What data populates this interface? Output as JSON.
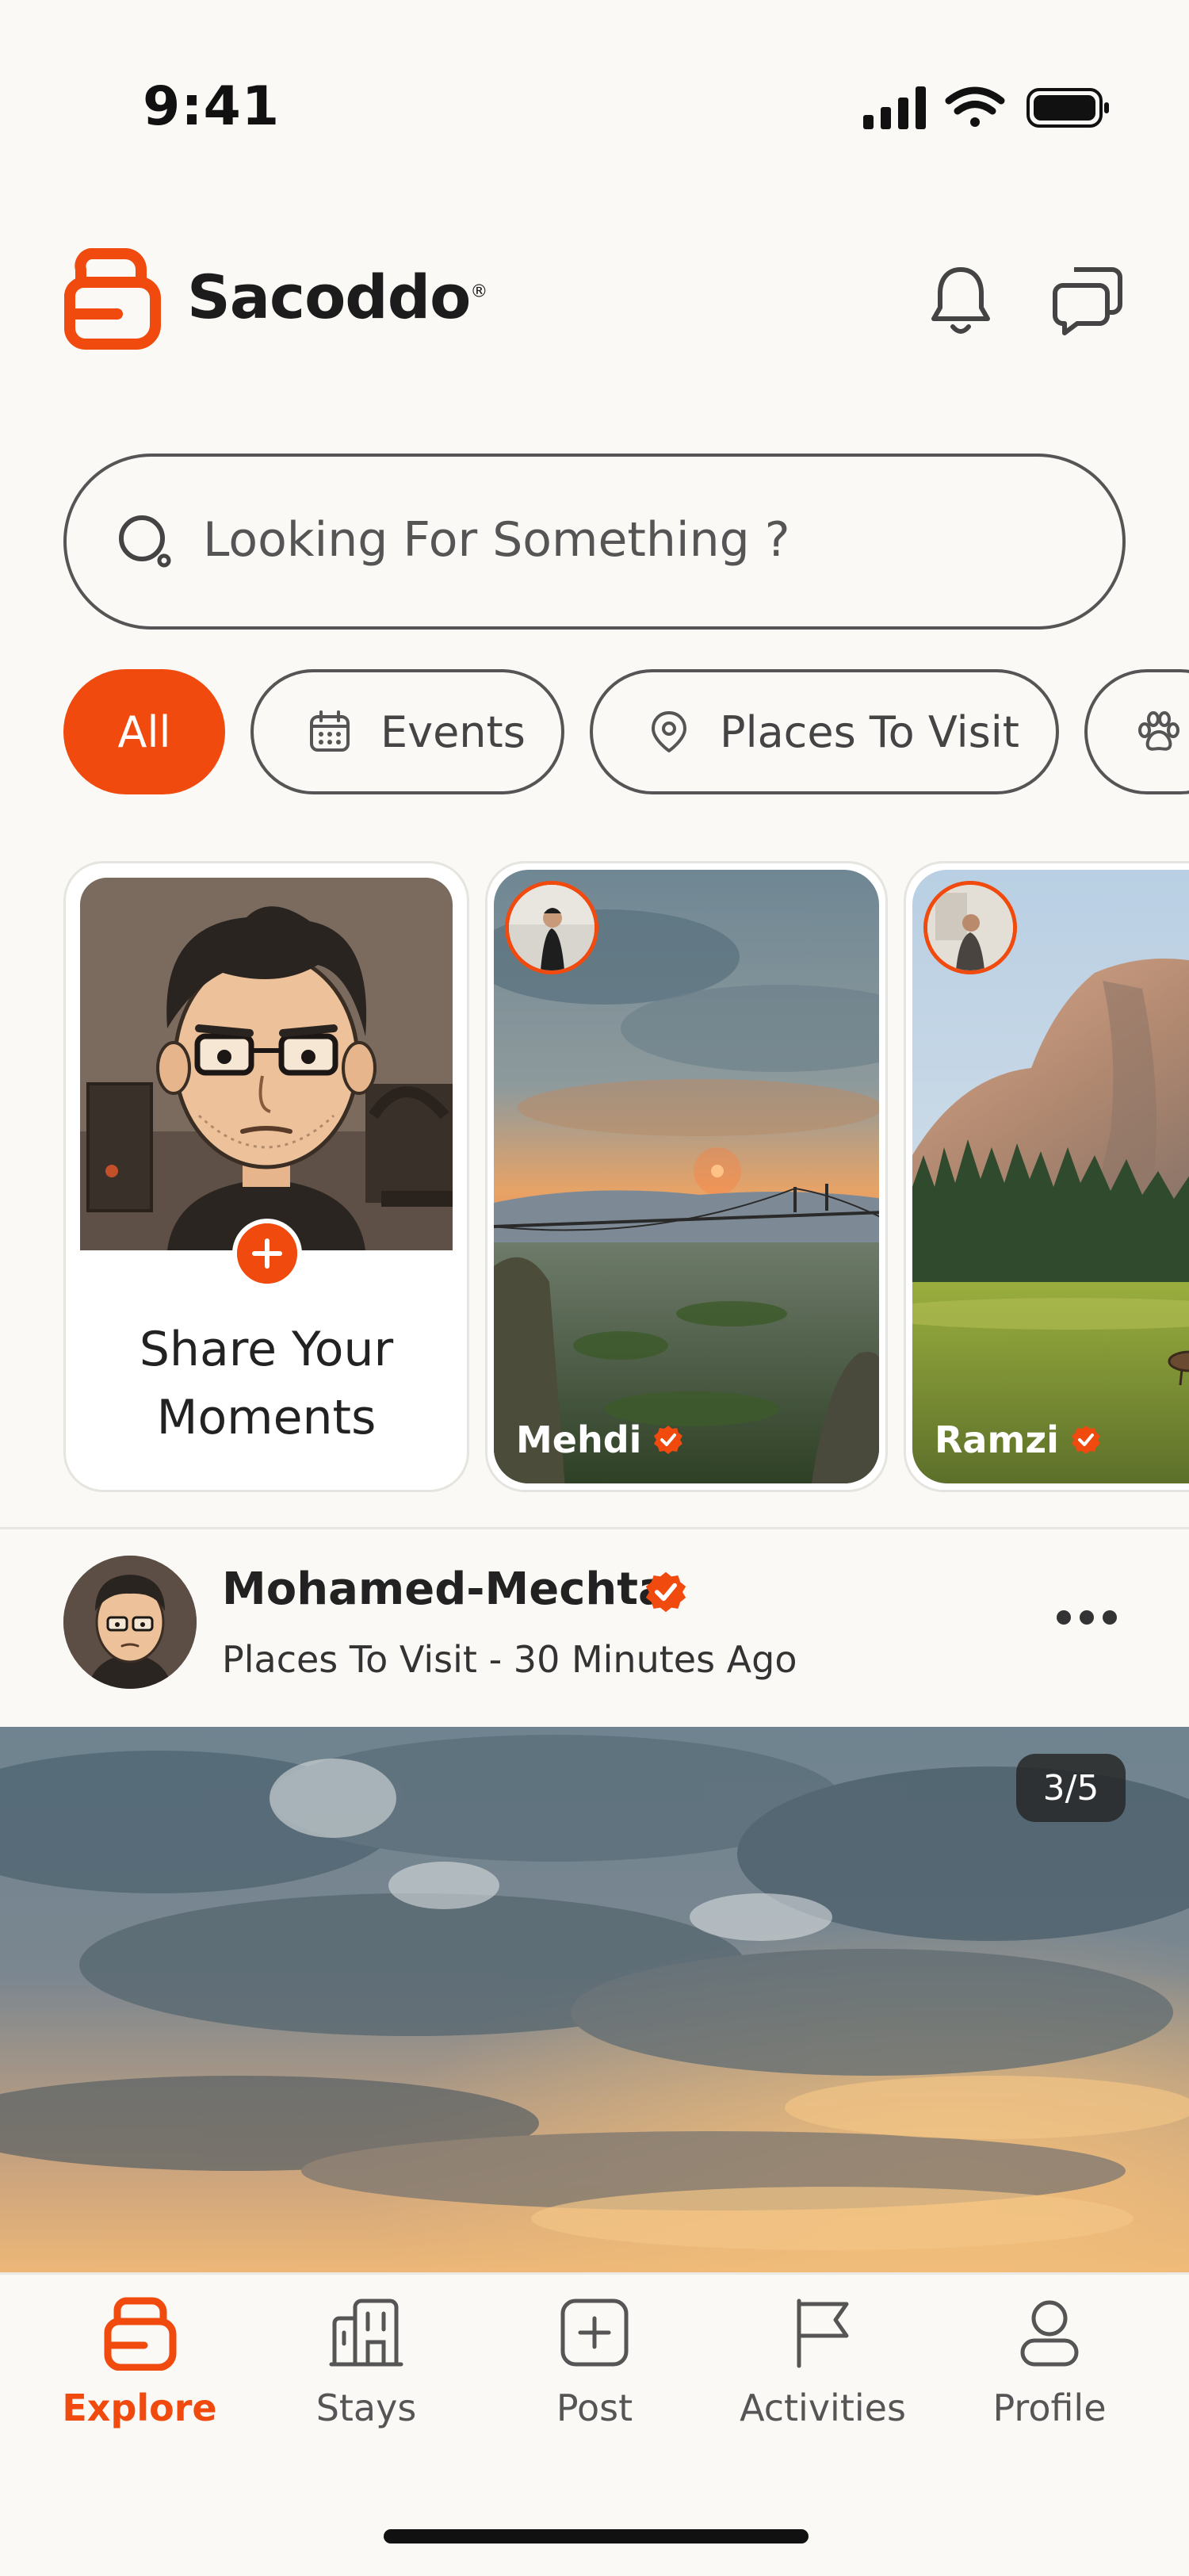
{
  "status_bar": {
    "time": "9:41"
  },
  "header": {
    "brand": "Sacoddo",
    "brand_mark": "®"
  },
  "search": {
    "placeholder": "Looking For Something ?"
  },
  "chips": [
    {
      "label": "All",
      "active": true
    },
    {
      "label": "Events",
      "icon": "calendar-icon"
    },
    {
      "label": "Places To Visit",
      "icon": "location-pin-icon"
    },
    {
      "label": "",
      "icon": "paw-icon"
    }
  ],
  "stories": {
    "share": {
      "label_line1": "Share Your",
      "label_line2": "Moments"
    },
    "items": [
      {
        "name": "Mehdi",
        "verified": true
      },
      {
        "name": "Ramzi",
        "verified": true
      }
    ]
  },
  "post": {
    "author": "Mohamed-Mechta",
    "verified": true,
    "meta": "Places To Visit - 30 Minutes Ago",
    "image_counter": "3/5"
  },
  "tabs": [
    {
      "label": "Explore",
      "icon": "explore-icon",
      "active": true
    },
    {
      "label": "Stays",
      "icon": "building-icon"
    },
    {
      "label": "Post",
      "icon": "add-post-icon"
    },
    {
      "label": "Activities",
      "icon": "flag-icon"
    },
    {
      "label": "Profile",
      "icon": "profile-icon"
    }
  ],
  "colors": {
    "accent": "#F04A0E",
    "background": "#FAF9F6",
    "text": "#1F1F1F"
  }
}
